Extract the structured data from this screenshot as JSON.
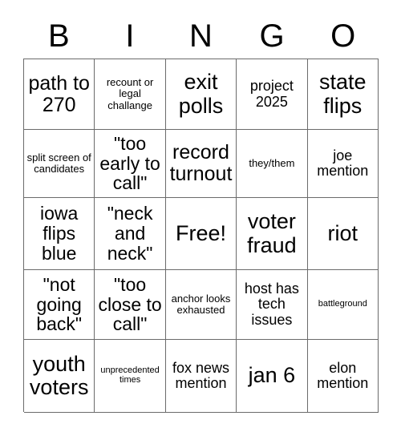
{
  "card": {
    "header_letters": [
      "B",
      "I",
      "N",
      "G",
      "O"
    ],
    "rows": [
      [
        {
          "text": "path to 270",
          "size": "lg"
        },
        {
          "text": "recount or legal challange",
          "size": "xs"
        },
        {
          "text": "exit polls",
          "size": "xl"
        },
        {
          "text": "project 2025",
          "size": "sm"
        },
        {
          "text": "state flips",
          "size": "xl"
        }
      ],
      [
        {
          "text": "split screen of candidates",
          "size": "xs"
        },
        {
          "text": "\"too early to call\"",
          "size": "md"
        },
        {
          "text": "record turnout",
          "size": "lg"
        },
        {
          "text": "they/them",
          "size": "xs"
        },
        {
          "text": "joe mention",
          "size": "sm"
        }
      ],
      [
        {
          "text": "iowa flips blue",
          "size": "md"
        },
        {
          "text": "\"neck and neck\"",
          "size": "md"
        },
        {
          "text": "Free!",
          "size": "xl"
        },
        {
          "text": "voter fraud",
          "size": "xl"
        },
        {
          "text": "riot",
          "size": "xl"
        }
      ],
      [
        {
          "text": "\"not going back\"",
          "size": "md"
        },
        {
          "text": "\"too close to call\"",
          "size": "md"
        },
        {
          "text": "anchor looks exhausted",
          "size": "xs"
        },
        {
          "text": "host has tech issues",
          "size": "sm"
        },
        {
          "text": "battleground",
          "size": "xxs"
        }
      ],
      [
        {
          "text": "youth voters",
          "size": "xl"
        },
        {
          "text": "unprecedented times",
          "size": "xxs"
        },
        {
          "text": "fox news mention",
          "size": "sm"
        },
        {
          "text": "jan 6",
          "size": "xl"
        },
        {
          "text": "elon mention",
          "size": "sm"
        }
      ]
    ]
  }
}
